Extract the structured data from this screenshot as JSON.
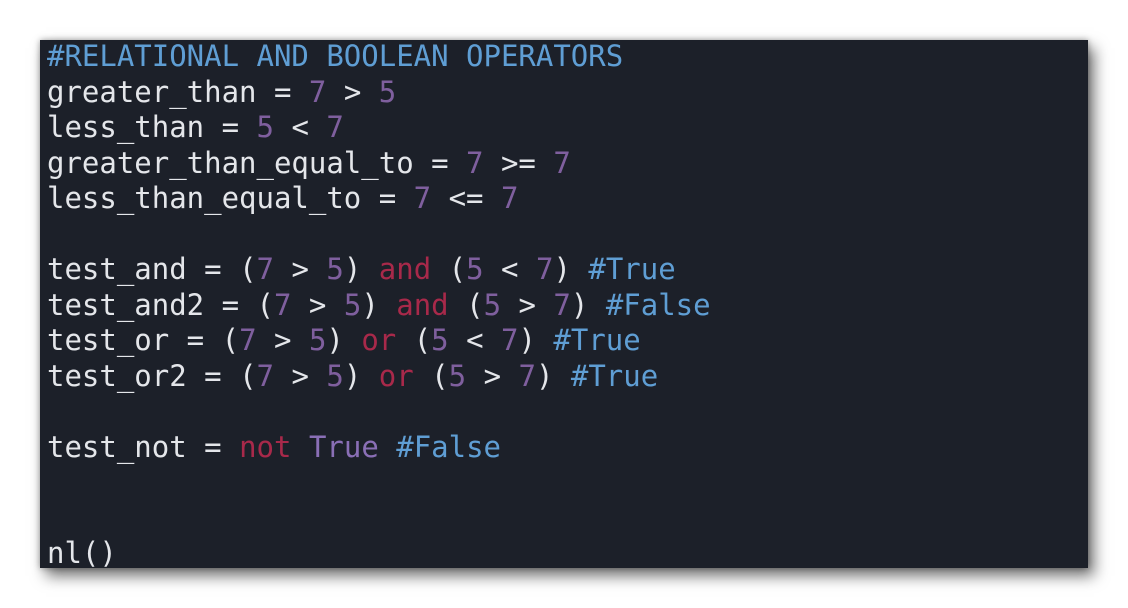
{
  "colors": {
    "background": "#1c2029",
    "text": "#e4e6ea",
    "number": "#7f5f9e",
    "keyword": "#a8294a",
    "builtin": "#8a6fb6",
    "comment": "#5f9ed4"
  },
  "editor": {
    "lines": [
      [
        {
          "type": "comment",
          "text": "#RELATIONAL AND BOOLEAN OPERATORS"
        }
      ],
      [
        {
          "type": "ident",
          "text": "greater_than"
        },
        {
          "type": "op",
          "text": " = "
        },
        {
          "type": "number",
          "text": "7"
        },
        {
          "type": "op",
          "text": " > "
        },
        {
          "type": "number",
          "text": "5"
        }
      ],
      [
        {
          "type": "ident",
          "text": "less_than"
        },
        {
          "type": "op",
          "text": " = "
        },
        {
          "type": "number",
          "text": "5"
        },
        {
          "type": "op",
          "text": " < "
        },
        {
          "type": "number",
          "text": "7"
        }
      ],
      [
        {
          "type": "ident",
          "text": "greater_than_equal_to"
        },
        {
          "type": "op",
          "text": " = "
        },
        {
          "type": "number",
          "text": "7"
        },
        {
          "type": "op",
          "text": " >= "
        },
        {
          "type": "number",
          "text": "7"
        }
      ],
      [
        {
          "type": "ident",
          "text": "less_than_equal_to"
        },
        {
          "type": "op",
          "text": " = "
        },
        {
          "type": "number",
          "text": "7"
        },
        {
          "type": "op",
          "text": " <= "
        },
        {
          "type": "number",
          "text": "7"
        }
      ],
      [],
      [
        {
          "type": "ident",
          "text": "test_and"
        },
        {
          "type": "op",
          "text": " = "
        },
        {
          "type": "punct",
          "text": "("
        },
        {
          "type": "number",
          "text": "7"
        },
        {
          "type": "op",
          "text": " > "
        },
        {
          "type": "number",
          "text": "5"
        },
        {
          "type": "punct",
          "text": ") "
        },
        {
          "type": "keyword",
          "text": "and"
        },
        {
          "type": "punct",
          "text": " ("
        },
        {
          "type": "number",
          "text": "5"
        },
        {
          "type": "op",
          "text": " < "
        },
        {
          "type": "number",
          "text": "7"
        },
        {
          "type": "punct",
          "text": ") "
        },
        {
          "type": "comment",
          "text": "#True"
        }
      ],
      [
        {
          "type": "ident",
          "text": "test_and2"
        },
        {
          "type": "op",
          "text": " = "
        },
        {
          "type": "punct",
          "text": "("
        },
        {
          "type": "number",
          "text": "7"
        },
        {
          "type": "op",
          "text": " > "
        },
        {
          "type": "number",
          "text": "5"
        },
        {
          "type": "punct",
          "text": ") "
        },
        {
          "type": "keyword",
          "text": "and"
        },
        {
          "type": "punct",
          "text": " ("
        },
        {
          "type": "number",
          "text": "5"
        },
        {
          "type": "op",
          "text": " > "
        },
        {
          "type": "number",
          "text": "7"
        },
        {
          "type": "punct",
          "text": ") "
        },
        {
          "type": "comment",
          "text": "#False"
        }
      ],
      [
        {
          "type": "ident",
          "text": "test_or"
        },
        {
          "type": "op",
          "text": " = "
        },
        {
          "type": "punct",
          "text": "("
        },
        {
          "type": "number",
          "text": "7"
        },
        {
          "type": "op",
          "text": " > "
        },
        {
          "type": "number",
          "text": "5"
        },
        {
          "type": "punct",
          "text": ") "
        },
        {
          "type": "keyword",
          "text": "or"
        },
        {
          "type": "punct",
          "text": " ("
        },
        {
          "type": "number",
          "text": "5"
        },
        {
          "type": "op",
          "text": " < "
        },
        {
          "type": "number",
          "text": "7"
        },
        {
          "type": "punct",
          "text": ") "
        },
        {
          "type": "comment",
          "text": "#True"
        }
      ],
      [
        {
          "type": "ident",
          "text": "test_or2"
        },
        {
          "type": "op",
          "text": " = "
        },
        {
          "type": "punct",
          "text": "("
        },
        {
          "type": "number",
          "text": "7"
        },
        {
          "type": "op",
          "text": " > "
        },
        {
          "type": "number",
          "text": "5"
        },
        {
          "type": "punct",
          "text": ") "
        },
        {
          "type": "keyword",
          "text": "or"
        },
        {
          "type": "punct",
          "text": " ("
        },
        {
          "type": "number",
          "text": "5"
        },
        {
          "type": "op",
          "text": " > "
        },
        {
          "type": "number",
          "text": "7"
        },
        {
          "type": "punct",
          "text": ") "
        },
        {
          "type": "comment",
          "text": "#True"
        }
      ],
      [],
      [
        {
          "type": "ident",
          "text": "test_not"
        },
        {
          "type": "op",
          "text": " = "
        },
        {
          "type": "keyword",
          "text": "not"
        },
        {
          "type": "punct",
          "text": " "
        },
        {
          "type": "builtin",
          "text": "True"
        },
        {
          "type": "punct",
          "text": " "
        },
        {
          "type": "comment",
          "text": "#False"
        }
      ],
      [],
      [],
      [
        {
          "type": "ident",
          "text": "nl"
        },
        {
          "type": "punct",
          "text": "()"
        }
      ]
    ]
  }
}
